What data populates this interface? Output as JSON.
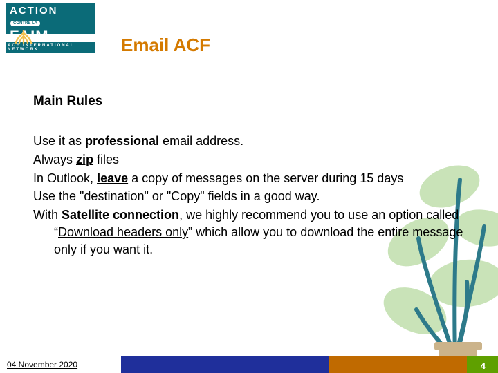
{
  "logo": {
    "line1": "ACTION",
    "pill": "CONTRE LA",
    "line2": "FAIM",
    "band": "ACF INTERNATIONAL NETWORK"
  },
  "title": "Email ACF",
  "subhead": "Main Rules",
  "rules": {
    "r1a": "Use it as ",
    "r1b": "professional",
    "r1c": " email address.",
    "r2a": "Always ",
    "r2b": "zip",
    "r2c": " files",
    "r3a": "In Outlook, ",
    "r3b": "leave",
    "r3c": " a copy of messages on the server during 15 days",
    "r4": "Use the \"destination\" or \"Copy\" fields in a good way.",
    "r5a": "With ",
    "r5b": "Satellite connection",
    "r5c": ", we highly recommend you to use an option called “",
    "r5d": "Download headers only",
    "r5e": "” which allow you to download the entire message only if you want it."
  },
  "footer": {
    "date": "04 November 2020",
    "page": "4"
  },
  "colors": {
    "title": "#d47a00",
    "logo_teal": "#0b6b78",
    "footer_blue": "#1f2f9b",
    "footer_orange": "#c06a00",
    "footer_green": "#5fa000"
  }
}
